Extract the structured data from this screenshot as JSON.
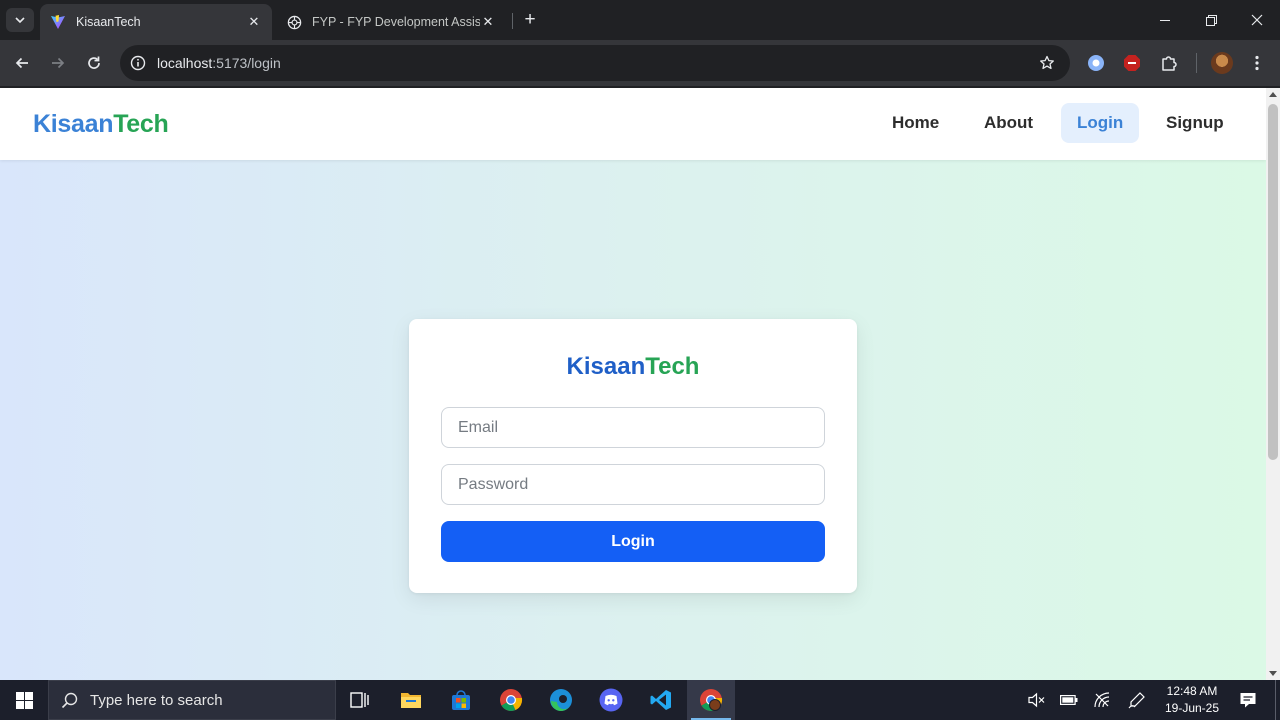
{
  "browser": {
    "tabs": [
      {
        "title": "KisaanTech",
        "favicon": "vite-icon",
        "active": true
      },
      {
        "title": "FYP - FYP Development Assistant",
        "favicon": "chatgpt-icon",
        "active": false
      }
    ],
    "url_host": "localhost",
    "url_path": ":5173/login"
  },
  "page": {
    "brand": {
      "part1": "Kisaan",
      "part2": "Tech"
    },
    "nav": {
      "home": "Home",
      "about": "About",
      "login": "Login",
      "signup": "Signup"
    },
    "nav_active": "login",
    "card": {
      "brand": {
        "part1": "Kisaan",
        "part2": "Tech"
      },
      "email_placeholder": "Email",
      "email_value": "",
      "password_placeholder": "Password",
      "password_value": "",
      "login_label": "Login"
    }
  },
  "colors": {
    "brand_blue": "#3b82d6",
    "brand_green": "#27a455",
    "primary_button": "#145ff5",
    "active_nav_bg": "#e4effd"
  },
  "taskbar": {
    "search_placeholder": "Type here to search",
    "apps": [
      "task-view-icon",
      "file-explorer-icon",
      "microsoft-store-icon",
      "chrome-icon",
      "edge-icon",
      "discord-icon",
      "vscode-icon",
      "chrome-profile-icon"
    ],
    "time": "12:48 AM",
    "date": "19-Jun-25"
  }
}
